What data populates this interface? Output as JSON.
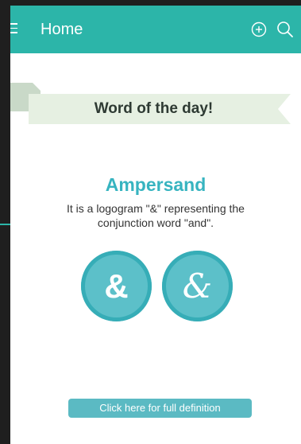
{
  "app_bar": {
    "title": "Home",
    "icons": [
      "menu-icon",
      "add-icon",
      "search-icon"
    ],
    "color": "#2cb5a9"
  },
  "banner": {
    "title": "Word of the day!"
  },
  "word": {
    "name": "Ampersand",
    "description": "It is a logogram \"&\" representing the conjunction word \"and\".",
    "symbols": [
      "&",
      "&"
    ]
  },
  "action": {
    "label": "Click here for full definition"
  },
  "colors": {
    "accent": "#2cb5a9",
    "word": "#37b4c0",
    "circle": "#5cc0c9",
    "button": "#5bbac3"
  }
}
